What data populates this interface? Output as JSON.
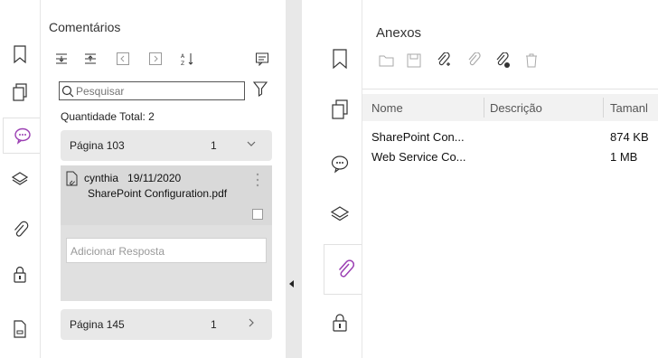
{
  "left_panel": {
    "title": "Comentários",
    "search_placeholder": "Pesquisar",
    "total_label": "Quantidade Total: 2",
    "groups": [
      {
        "label": "Página 103",
        "count": "1",
        "expanded": true
      },
      {
        "label": "Página 145",
        "count": "1",
        "expanded": false
      }
    ],
    "comment": {
      "author_date": "cynthia   19/11/2020",
      "file": "SharePoint Configuration.pdf",
      "reply_placeholder": "Adicionar Resposta"
    }
  },
  "right_panel": {
    "title": "Anexos",
    "columns": [
      "Nome",
      "Descrição",
      "Tamanl"
    ],
    "rows": [
      {
        "name": "SharePoint Con...",
        "description": "",
        "size": "874 KB"
      },
      {
        "name": "Web Service Co...",
        "description": "",
        "size": "1 MB"
      }
    ]
  },
  "colors": {
    "accent_purple": "#9b3fb3",
    "active_tab_border": "#e1e1e1",
    "card_bg": "#e0e0e0"
  }
}
